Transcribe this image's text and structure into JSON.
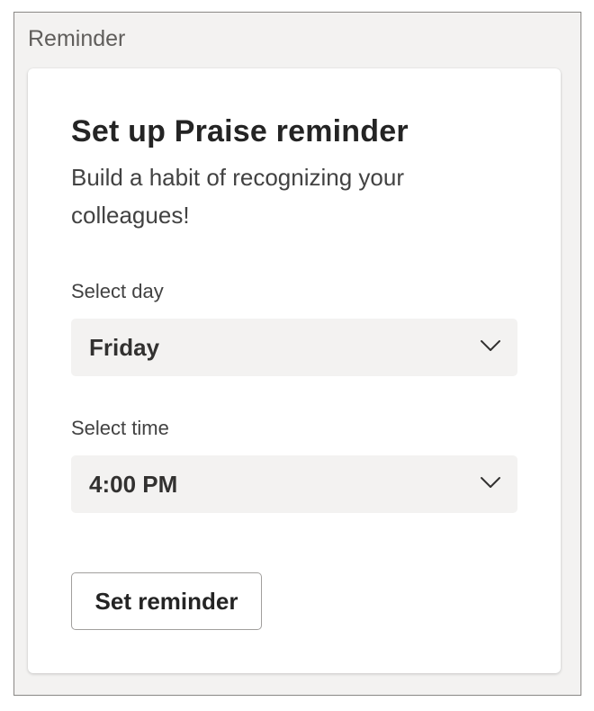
{
  "panel": {
    "title": "Reminder"
  },
  "card": {
    "title": "Set up Praise reminder",
    "subtitle": "Build a habit of recognizing your colleagues!"
  },
  "day_field": {
    "label": "Select day",
    "selected_value": "Friday"
  },
  "time_field": {
    "label": "Select time",
    "selected_value": "4:00 PM"
  },
  "actions": {
    "set_reminder_label": "Set reminder"
  },
  "icons": {
    "dropdown": "chevron-down-icon"
  },
  "colors": {
    "panel_background": "#f3f2f1",
    "card_background": "#ffffff",
    "select_background": "#f3f2f1",
    "title_text": "#242424",
    "body_text": "#424242"
  }
}
